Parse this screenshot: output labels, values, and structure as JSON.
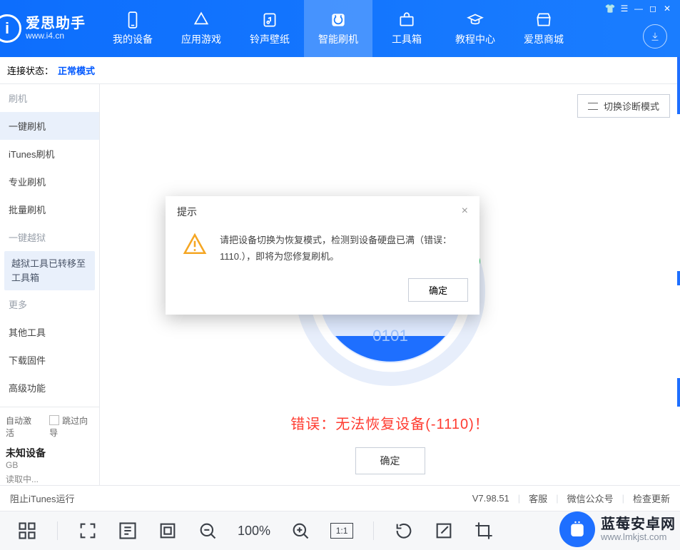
{
  "brand": {
    "name": "爱思助手",
    "sub": "www.i4.cn",
    "logo_glyph": "i"
  },
  "window_buttons": {
    "shirt": "👕",
    "list": "☰",
    "min": "—",
    "max": "◻",
    "close": "✕"
  },
  "topnav": [
    {
      "id": "device",
      "label": "我的设备"
    },
    {
      "id": "apps",
      "label": "应用游戏"
    },
    {
      "id": "ringtone",
      "label": "铃声壁纸"
    },
    {
      "id": "flash",
      "label": "智能刷机"
    },
    {
      "id": "toolbox",
      "label": "工具箱"
    },
    {
      "id": "tutorial",
      "label": "教程中心"
    },
    {
      "id": "mall",
      "label": "爱思商城"
    }
  ],
  "status": {
    "label": "连接状态：",
    "value": "正常模式"
  },
  "sidebar": {
    "cats": {
      "flash": "刷机",
      "jailbreak": "一键越狱",
      "more": "更多"
    },
    "items": {
      "oneclick": "一键刷机",
      "itunes": "iTunes刷机",
      "pro": "专业刷机",
      "batch": "批量刷机",
      "jb_note": "越狱工具已转移至工具箱",
      "other": "其他工具",
      "firmware": "下载固件",
      "adv": "高级功能"
    },
    "bottom": {
      "auto": "自动激活",
      "skip": "跳过向导",
      "device": "未知设备",
      "cap": "GB",
      "reading": "读取中..."
    }
  },
  "content": {
    "diag_btn": "切换诊断模式",
    "error_text": "错误：无法恢复设备(-1110)！",
    "confirm": "确定"
  },
  "dialog": {
    "title": "提示",
    "message": "请把设备切换为恢复模式，检测到设备硬盘已满（错误：1110.），即将为您修复刷机。",
    "ok": "确定",
    "close": "×"
  },
  "footer": {
    "left": "阻止iTunes运行",
    "version": "V7.98.51",
    "service": "客服",
    "wechat": "微信公众号",
    "update": "检查更新"
  },
  "viewer": {
    "zoom": "100%",
    "ratio": "1:1"
  },
  "watermark": {
    "name": "蓝莓安卓网",
    "sub": "www.lmkjst.com"
  }
}
